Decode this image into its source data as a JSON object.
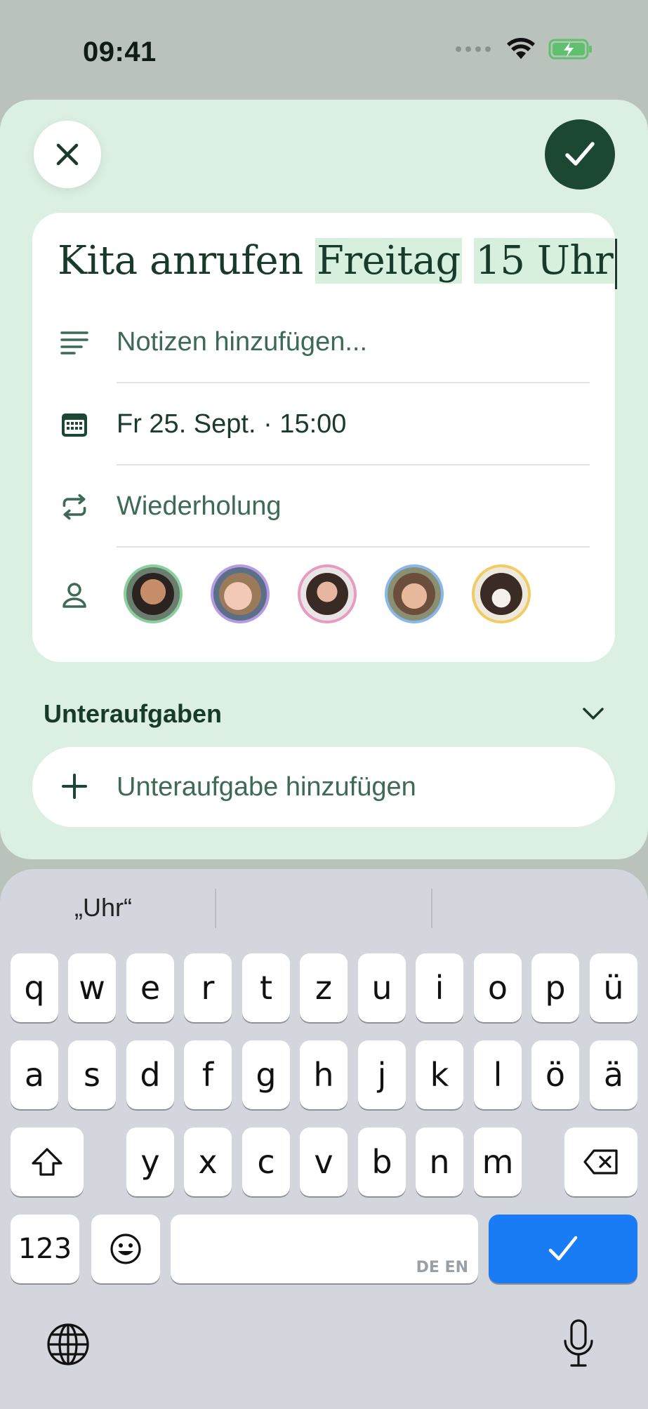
{
  "status_bar": {
    "time": "09:41"
  },
  "editor": {
    "title_plain": "Kita anrufen ",
    "title_highlight_1": "Freitag",
    "title_highlight_2": "15 Uhr",
    "notes_placeholder": "Notizen hinzufügen...",
    "due_date": "Fr 25. Sept. · 15:00",
    "repeat_label": "Wiederholung",
    "assignees": [
      {
        "name": "avatar-man",
        "ring": "#8ccf9f"
      },
      {
        "name": "avatar-girl",
        "ring": "#b59be4"
      },
      {
        "name": "avatar-woman",
        "ring": "#e79ac2"
      },
      {
        "name": "avatar-boy",
        "ring": "#8ab6e8"
      },
      {
        "name": "avatar-dog",
        "ring": "#f0cc62"
      }
    ]
  },
  "subtasks": {
    "title": "Unteraufgaben",
    "add_label": "Unteraufgabe hinzufügen"
  },
  "keyboard": {
    "suggestion": "„Uhr“",
    "row1": [
      "q",
      "w",
      "e",
      "r",
      "t",
      "z",
      "u",
      "i",
      "o",
      "p",
      "ü"
    ],
    "row2": [
      "a",
      "s",
      "d",
      "f",
      "g",
      "h",
      "j",
      "k",
      "l",
      "ö",
      "ä"
    ],
    "row3": [
      "y",
      "x",
      "c",
      "v",
      "b",
      "n",
      "m"
    ],
    "numbers_key": "123",
    "space_hint": "DE EN"
  },
  "colors": {
    "sheet_bg": "#dcefe3",
    "primary": "#1c4733",
    "highlight": "#d7f0de",
    "return_key": "#1a7cf5"
  },
  "icons": [
    "close-icon",
    "checkmark-icon",
    "notes-icon",
    "calendar-icon",
    "repeat-icon",
    "person-icon",
    "chevron-down-icon",
    "plus-icon",
    "shift-icon",
    "delete-icon",
    "emoji-icon",
    "globe-icon",
    "microphone-icon",
    "wifi-icon",
    "battery-charging-icon"
  ]
}
